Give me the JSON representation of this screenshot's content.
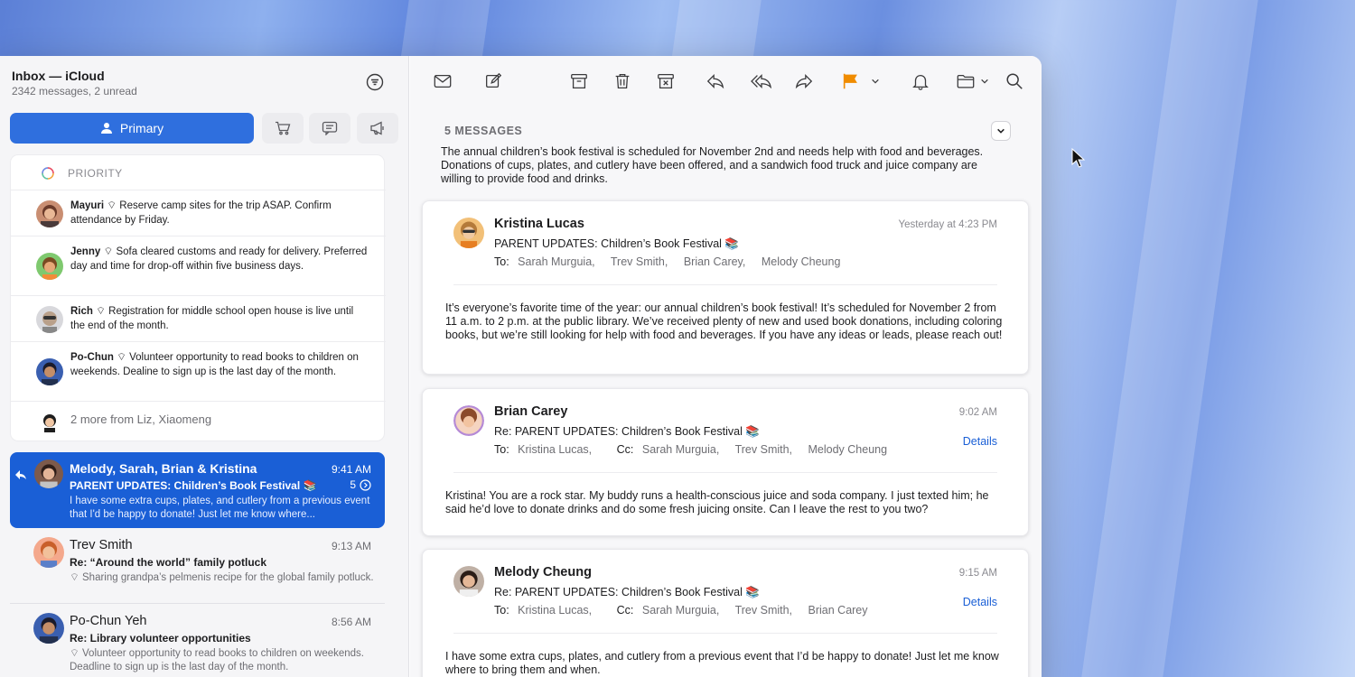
{
  "mailbox": {
    "title": "Inbox — iCloud",
    "subtitle": "2342 messages, 2 unread"
  },
  "categories": {
    "primary_label": "Primary",
    "others": [
      "shopping-cart-icon",
      "chat-bubble-icon",
      "megaphone-icon"
    ]
  },
  "priority": {
    "header": "PRIORITY",
    "items": [
      {
        "sender": "Mayuri",
        "text": "Reserve camp sites for the trip ASAP. Confirm attendance by Friday."
      },
      {
        "sender": "Jenny",
        "text": "Sofa cleared customs and ready for delivery. Preferred day and time for drop-off within five business days."
      },
      {
        "sender": "Rich",
        "text": "Registration for middle school open house is live until the end of the month."
      },
      {
        "sender": "Po-Chun",
        "text": "Volunteer opportunity to read books to children on weekends. Dealine to sign up is the last day of the month."
      }
    ],
    "more": "2 more from Liz, Xiaomeng"
  },
  "message_list": [
    {
      "name": "Melody, Sarah, Brian & Kristina",
      "time": "9:41 AM",
      "subject": "PARENT UPDATES: Children’s Book Festival 📚",
      "count": "5",
      "preview": "I have some extra cups, plates, and cutlery from a previous event that I'd be happy to donate! Just let me know where..."
    },
    {
      "name": "Trev Smith",
      "time": "9:13 AM",
      "subject": "Re: “Around the world” family potluck",
      "preview": "Sharing grandpa’s pelmenis recipe for the global family potluck."
    },
    {
      "name": "Po-Chun Yeh",
      "time": "8:56 AM",
      "subject": "Re: Library volunteer opportunities",
      "preview": "Volunteer opportunity to read books to children on weekends. Deadline to sign up is the last day of the month."
    }
  ],
  "thread": {
    "count_label": "5 MESSAGES",
    "summary": "The annual children’s book festival is scheduled for November 2nd and needs help with food and beverages. Donations of cups, plates, and cutlery have been offered, and a sandwich food truck and juice company are willing to provide food and drinks.",
    "to_label": "To:",
    "cc_label": "Cc:",
    "details_label": "Details",
    "messages": [
      {
        "from": "Kristina Lucas",
        "subject": "PARENT UPDATES: Children’s Book Festival 📚",
        "to": [
          "Sarah Murguia,",
          "Trev Smith,",
          "Brian Carey,",
          "Melody Cheung"
        ],
        "cc": [],
        "time": "Yesterday at 4:23 PM",
        "body": "It’s everyone’s favorite time of the year: our annual children’s book festival! It’s scheduled for November 2 from 11 a.m. to 2 p.m. at the public library. We’ve received plenty of new and used book donations, including coloring books, but we’re still looking for help with food and beverages. If you have any ideas or leads, please reach out!"
      },
      {
        "from": "Brian Carey",
        "subject": "Re: PARENT UPDATES: Children’s Book Festival 📚",
        "to": [
          "Kristina Lucas,"
        ],
        "cc": [
          "Sarah Murguia,",
          "Trev Smith,",
          "Melody Cheung"
        ],
        "time": "9:02 AM",
        "body": "Kristina! You are a rock star. My buddy runs a health-conscious juice and soda company. I just texted him; he said he’d love to donate drinks and do some fresh juicing onsite. Can I leave the rest to you two?"
      },
      {
        "from": "Melody Cheung",
        "subject": "Re: PARENT UPDATES: Children’s Book Festival 📚",
        "to": [
          "Kristina Lucas,"
        ],
        "cc": [
          "Sarah Murguia,",
          "Trev Smith,",
          "Brian Carey"
        ],
        "time": "9:15 AM",
        "body": "I have some extra cups, plates, and cutlery from a previous event that I’d be happy to donate! Just let me know where to bring them and when."
      }
    ]
  },
  "colors": {
    "accent": "#1a5fd6",
    "flag": "#f08c00"
  }
}
